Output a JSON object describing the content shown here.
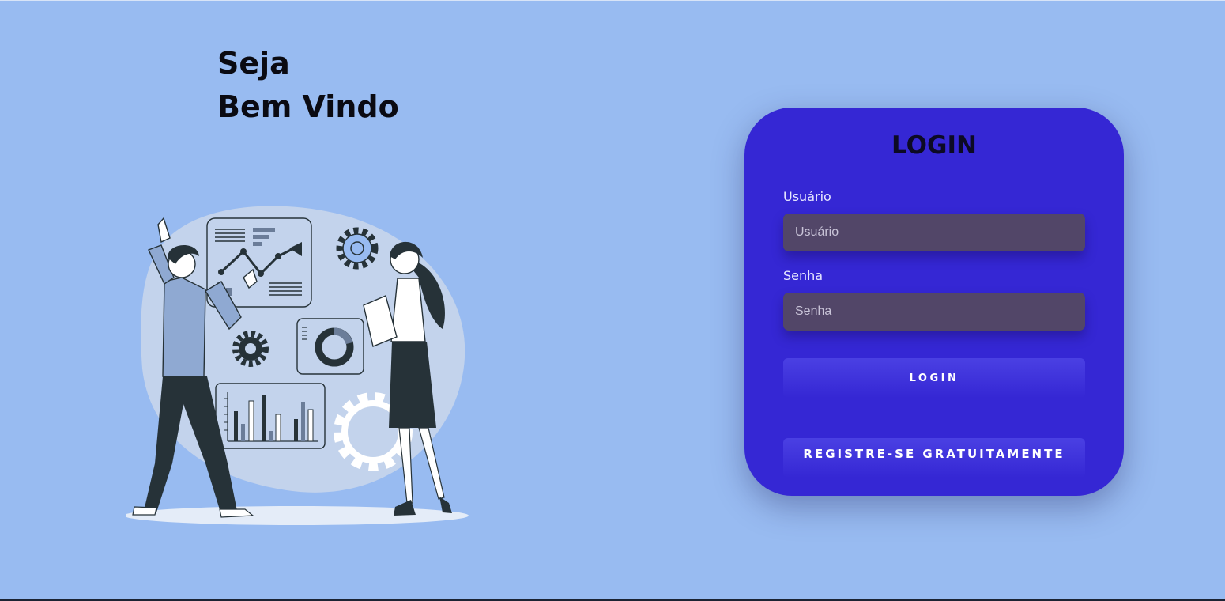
{
  "welcome": {
    "line1": "Seja",
    "line2": "Bem Vindo"
  },
  "login_card": {
    "title": "LOGIN",
    "username": {
      "label": "Usuário",
      "placeholder": "Usuário",
      "value": ""
    },
    "password": {
      "label": "Senha",
      "placeholder": "Senha",
      "value": ""
    },
    "login_button": "LOGIN",
    "register_button": "REGISTRE-SE GRATUITAMENTE"
  },
  "colors": {
    "background": "#98bbf1",
    "card": "#3527d4",
    "input": "#524668",
    "illustration_dark": "#263238",
    "illustration_blob": "#c3d3ec"
  },
  "illustration": {
    "name": "team-analytics-illustration"
  }
}
